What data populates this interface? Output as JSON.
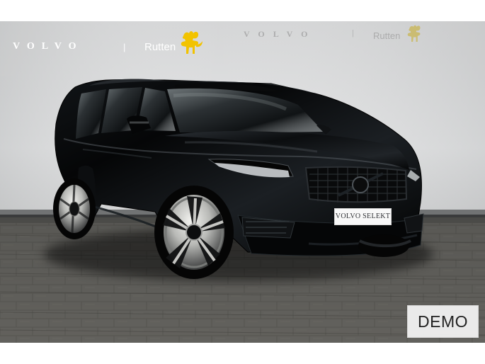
{
  "branding": {
    "brand_wordmark": "VOLVO",
    "divider": "|",
    "dealer_name": "Rutten",
    "ghost_brand_wordmark": "VOLVO",
    "ghost_divider": "|",
    "ghost_dealer_name": "Rutten",
    "logo_icon": "moose-icon",
    "logo_color": "#f2c300"
  },
  "vehicle": {
    "plate_text": "VOLVO SELEKT",
    "body_color": "#050607"
  },
  "overlay": {
    "demo_label": "DEMO"
  },
  "scene": {
    "wall_color": "#d7d8d8",
    "ground_color": "#5d5c57"
  }
}
